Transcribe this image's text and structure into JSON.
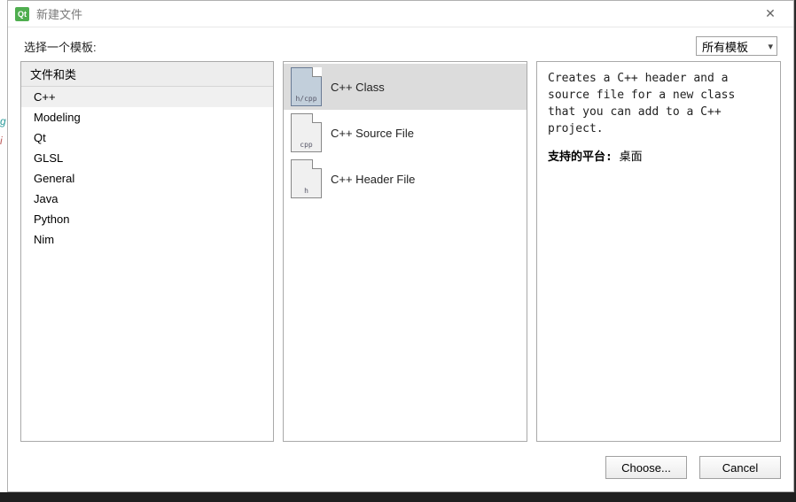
{
  "title": "新建文件",
  "prompt": "选择一个模板:",
  "filter": {
    "selected": "所有模板"
  },
  "categories": {
    "header": "文件和类",
    "items": [
      "C++",
      "Modeling",
      "Qt",
      "GLSL",
      "General",
      "Java",
      "Python",
      "Nim"
    ],
    "selected_index": 0
  },
  "templates": [
    {
      "label": "C++ Class",
      "icon_ext": "h/cpp",
      "selected": true
    },
    {
      "label": "C++ Source File",
      "icon_ext": "cpp",
      "selected": false
    },
    {
      "label": "C++ Header File",
      "icon_ext": "h",
      "selected": false
    }
  ],
  "description": "Creates a C++ header and a source file for a new class that you can add to a C++ project.",
  "platform": {
    "label": "支持的平台:",
    "value": "桌面"
  },
  "buttons": {
    "choose": "Choose...",
    "cancel": "Cancel"
  }
}
